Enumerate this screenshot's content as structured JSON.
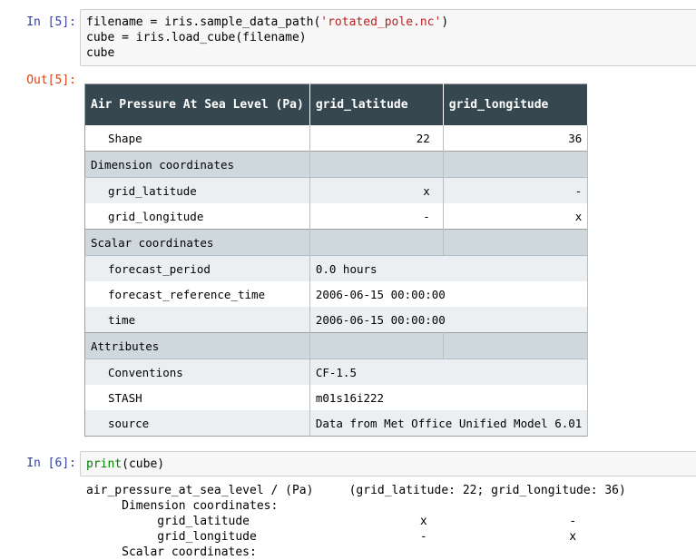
{
  "cell5": {
    "in_prompt": "In [5]:",
    "out_prompt": "Out[5]:",
    "code": {
      "l1_a": "filename = iris.sample_data_path(",
      "l1_str": "'rotated_pole.nc'",
      "l1_b": ")",
      "l2": "cube = iris.load_cube(filename)",
      "l3": "cube"
    },
    "table": {
      "headers": [
        "Air Pressure At Sea Level (Pa)",
        "grid_latitude",
        "grid_longitude"
      ],
      "shape": {
        "label": "Shape",
        "lat": "22",
        "lon": "36"
      },
      "dim_title": "Dimension coordinates",
      "dims": [
        {
          "label": "grid_latitude",
          "lat": "x",
          "lon": "-"
        },
        {
          "label": "grid_longitude",
          "lat": "-",
          "lon": "x"
        }
      ],
      "scalar_title": "Scalar coordinates",
      "scalars": [
        {
          "label": "forecast_period",
          "value": "0.0 hours"
        },
        {
          "label": "forecast_reference_time",
          "value": "2006-06-15 00:00:00"
        },
        {
          "label": "time",
          "value": "2006-06-15 00:00:00"
        }
      ],
      "attr_title": "Attributes",
      "attrs": [
        {
          "label": "Conventions",
          "value": "CF-1.5"
        },
        {
          "label": "STASH",
          "value": "m01s16i222"
        },
        {
          "label": "source",
          "value": "Data from Met Office Unified Model 6.01"
        }
      ]
    }
  },
  "cell6": {
    "in_prompt": "In [6]:",
    "code": {
      "fn": "print",
      "arg": "cube"
    },
    "output_lines": [
      "air_pressure_at_sea_level / (Pa)     (grid_latitude: 22; grid_longitude: 36)",
      "     Dimension coordinates:",
      "          grid_latitude                        x                    -",
      "          grid_longitude                       -                    x",
      "     Scalar coordinates:"
    ]
  }
}
